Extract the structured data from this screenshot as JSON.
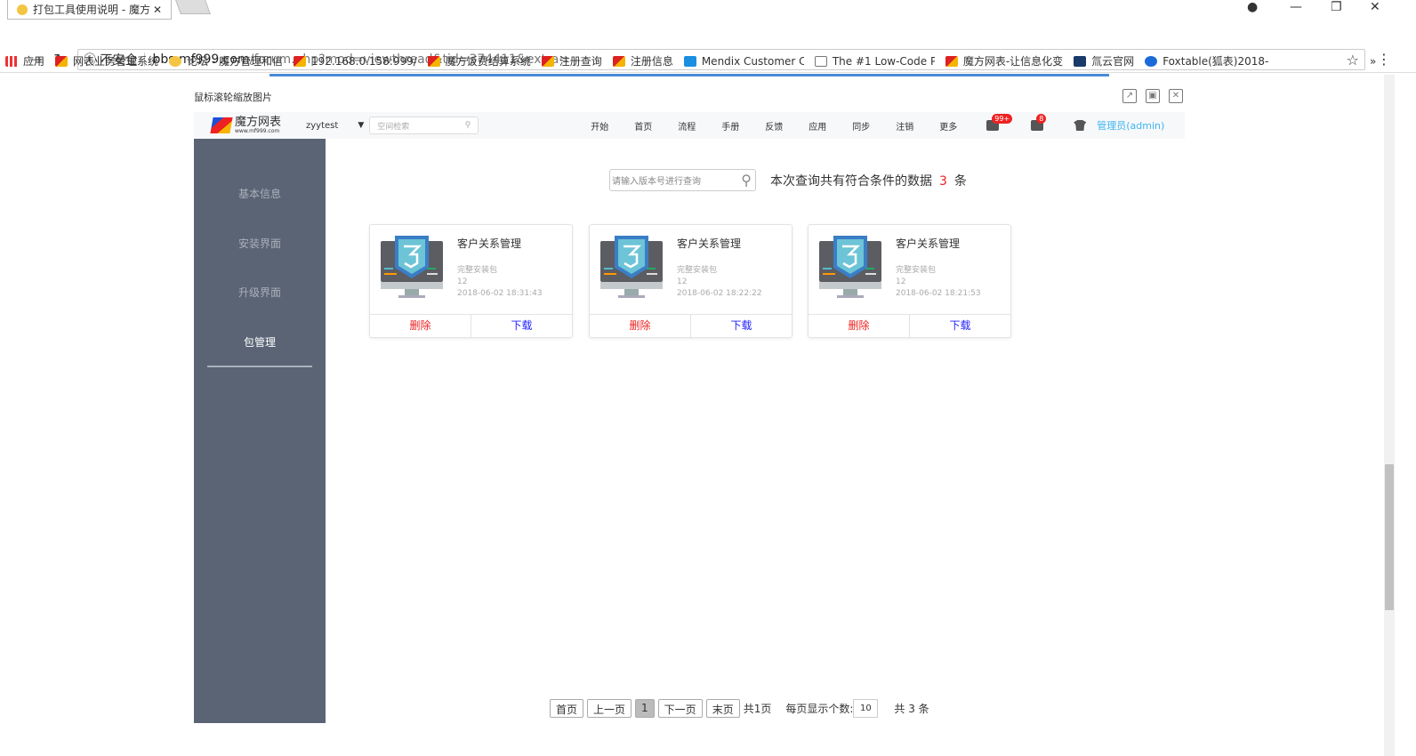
{
  "browser": {
    "tab_title": "打包工具使用说明 - 魔方",
    "security_label": "不安全",
    "url_host": "bbs.mf999.com",
    "url_path": "/forum.php?mod=viewthread&tid=374411&extra=",
    "bookmarks": [
      "应用",
      "网表业务管理系统",
      "论坛 - 魔方管理和信",
      "192.168.0.158:999/",
      "魔方饭费结算系统",
      "注册查询",
      "注册信息",
      "Mendix Customer C",
      "The #1 Low-Code P",
      "魔方网表-让信息化变",
      "氚云官网",
      "Foxtable(狐表)2018-"
    ]
  },
  "overlay": {
    "title": "鼠标滚轮缩放图片"
  },
  "header": {
    "logo_text": "魔方网表",
    "logo_sub": "www.mf999.com",
    "user": "zyytest",
    "search_placeholder": "空间检索",
    "menu": [
      "开始",
      "首页",
      "流程",
      "手册",
      "反馈",
      "应用",
      "同步",
      "注销",
      "更多"
    ],
    "messages_badge": "99+",
    "tasks_badge": "8",
    "admin": "管理员(admin)",
    "colors": {
      "accent": "#3cb5f0",
      "badge": "#ee2222"
    }
  },
  "sidebar": {
    "items": [
      "基本信息",
      "安装界面",
      "升级界面",
      "包管理"
    ],
    "active": "包管理"
  },
  "main": {
    "search_placeholder": "请输入版本号进行查询",
    "count_prefix": "本次查询共有符合条件的数据",
    "count": "3",
    "count_suffix": "条",
    "cards": [
      {
        "name": "客户关系管理",
        "type": "完整安装包",
        "version": "12",
        "time": "2018-06-02 18:31:43",
        "delete": "删除",
        "download": "下载"
      },
      {
        "name": "客户关系管理",
        "type": "完整安装包",
        "version": "12",
        "time": "2018-06-02 18:22:22",
        "delete": "删除",
        "download": "下载"
      },
      {
        "name": "客户关系管理",
        "type": "完整安装包",
        "version": "12",
        "time": "2018-06-02 18:21:53",
        "delete": "删除",
        "download": "下载"
      }
    ]
  },
  "pager": {
    "first": "首页",
    "prev": "上一页",
    "current": "1",
    "next": "下一页",
    "last": "末页",
    "total_pages": "共1页",
    "per_page_label": "每页显示个数:",
    "per_page": "10",
    "total": "共 3 条"
  }
}
